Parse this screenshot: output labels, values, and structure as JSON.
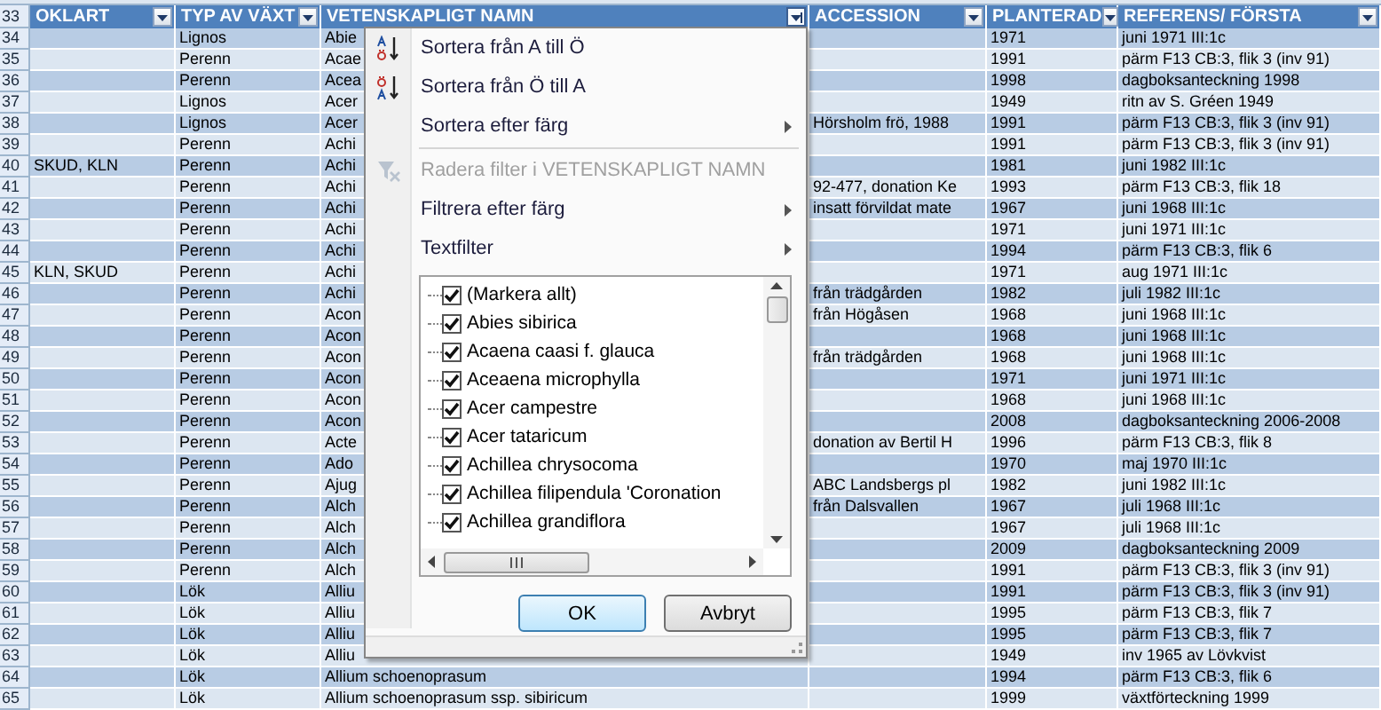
{
  "sheet": {
    "header_number": "33",
    "columns": [
      {
        "label": "OKLART",
        "filter_open": false
      },
      {
        "label": "TYP AV VÄXT",
        "filter_open": false
      },
      {
        "label": "VETENSKAPLIGT NAMN",
        "filter_open": true
      },
      {
        "label": "ACCESSION",
        "filter_open": false
      },
      {
        "label": "PLANTERAD",
        "filter_open": false
      },
      {
        "label": "REFERENS/ FÖRSTA",
        "filter_open": false
      }
    ],
    "rows": [
      {
        "number": "34",
        "typ_av_vaxt": "Lignos",
        "vetenskapligt_namn": "Abie",
        "planterad": "1971",
        "referens": "juni 1971 III:1c"
      },
      {
        "number": "35",
        "typ_av_vaxt": "Perenn",
        "vetenskapligt_namn": "Acae",
        "planterad": "1991",
        "referens": "pärm F13 CB:3, flik 3 (inv 91)"
      },
      {
        "number": "36",
        "typ_av_vaxt": "Perenn",
        "vetenskapligt_namn": "Acea",
        "planterad": "1998",
        "referens": "dagboksanteckning 1998"
      },
      {
        "number": "37",
        "typ_av_vaxt": "Lignos",
        "vetenskapligt_namn": "Acer",
        "planterad": "1949",
        "referens": "ritn av S. Gréen 1949"
      },
      {
        "number": "38",
        "typ_av_vaxt": "Lignos",
        "vetenskapligt_namn": "Acer",
        "accession": "Hörsholm frö, 1988",
        "planterad": "1991",
        "referens": "pärm F13 CB:3, flik 3 (inv 91)"
      },
      {
        "number": "39",
        "typ_av_vaxt": "Perenn",
        "vetenskapligt_namn": "Achi",
        "planterad": "1991",
        "referens": "pärm F13 CB:3, flik 3 (inv 91)"
      },
      {
        "number": "40",
        "oklart": "SKUD, KLN",
        "typ_av_vaxt": "Perenn",
        "vetenskapligt_namn": "Achi",
        "planterad": "1981",
        "referens": "juni 1982 III:1c"
      },
      {
        "number": "41",
        "typ_av_vaxt": "Perenn",
        "vetenskapligt_namn": "Achi",
        "accession": "92-477, donation Ke",
        "planterad": "1993",
        "referens": "pärm F13 CB:3, flik 18"
      },
      {
        "number": "42",
        "typ_av_vaxt": "Perenn",
        "vetenskapligt_namn": "Achi",
        "accession": "insatt förvildat mate",
        "planterad": "1967",
        "referens": "juni 1968 III:1c"
      },
      {
        "number": "43",
        "typ_av_vaxt": "Perenn",
        "vetenskapligt_namn": "Achi",
        "planterad": "1971",
        "referens": "juni 1971 III:1c"
      },
      {
        "number": "44",
        "typ_av_vaxt": "Perenn",
        "vetenskapligt_namn": "Achi",
        "planterad": "1994",
        "referens": "pärm F13 CB:3, flik 6"
      },
      {
        "number": "45",
        "oklart": "KLN, SKUD",
        "typ_av_vaxt": "Perenn",
        "vetenskapligt_namn": "Achi",
        "planterad": "1971",
        "referens": "aug 1971 III:1c"
      },
      {
        "number": "46",
        "typ_av_vaxt": "Perenn",
        "vetenskapligt_namn": "Achi",
        "accession": "från trädgården",
        "planterad": "1982",
        "referens": "juli 1982 III:1c"
      },
      {
        "number": "47",
        "typ_av_vaxt": "Perenn",
        "vetenskapligt_namn": "Acon",
        "accession": "från Högåsen",
        "planterad": "1968",
        "referens": "juni 1968 III:1c"
      },
      {
        "number": "48",
        "typ_av_vaxt": "Perenn",
        "vetenskapligt_namn": "Acon",
        "planterad": "1968",
        "referens": "juni 1968 III:1c"
      },
      {
        "number": "49",
        "typ_av_vaxt": "Perenn",
        "vetenskapligt_namn": "Acon",
        "accession": "från trädgården",
        "planterad": "1968",
        "referens": "juni 1968 III:1c"
      },
      {
        "number": "50",
        "typ_av_vaxt": "Perenn",
        "vetenskapligt_namn": "Acon",
        "planterad": "1971",
        "referens": "juni 1971 III:1c"
      },
      {
        "number": "51",
        "typ_av_vaxt": "Perenn",
        "vetenskapligt_namn": "Acon",
        "planterad": "1968",
        "referens": "juni 1968 III:1c"
      },
      {
        "number": "52",
        "typ_av_vaxt": "Perenn",
        "vetenskapligt_namn": "Acon",
        "planterad": "2008",
        "referens": "dagboksanteckning 2006-2008"
      },
      {
        "number": "53",
        "typ_av_vaxt": "Perenn",
        "vetenskapligt_namn": "Acte",
        "accession": "donation av Bertil H",
        "planterad": "1996",
        "referens": "pärm F13 CB:3, flik 8"
      },
      {
        "number": "54",
        "typ_av_vaxt": "Perenn",
        "vetenskapligt_namn": "Ado",
        "planterad": "1970",
        "referens": "maj 1970 III:1c"
      },
      {
        "number": "55",
        "typ_av_vaxt": "Perenn",
        "vetenskapligt_namn": "Ajug",
        "accession": "ABC Landsbergs pl",
        "planterad": "1982",
        "referens": "juni 1982 III:1c"
      },
      {
        "number": "56",
        "typ_av_vaxt": "Perenn",
        "vetenskapligt_namn": "Alch",
        "accession": "från Dalsvallen",
        "planterad": "1967",
        "referens": "juli 1968 III:1c"
      },
      {
        "number": "57",
        "typ_av_vaxt": "Perenn",
        "vetenskapligt_namn": "Alch",
        "planterad": "1967",
        "referens": "juli 1968 III:1c"
      },
      {
        "number": "58",
        "typ_av_vaxt": "Perenn",
        "vetenskapligt_namn": "Alch",
        "planterad": "2009",
        "referens": "dagboksanteckning 2009"
      },
      {
        "number": "59",
        "typ_av_vaxt": "Perenn",
        "vetenskapligt_namn": "Alch",
        "planterad": "1991",
        "referens": "pärm F13 CB:3, flik 3 (inv 91)"
      },
      {
        "number": "60",
        "typ_av_vaxt": "Lök",
        "vetenskapligt_namn": "Alliu",
        "planterad": "1991",
        "referens": "pärm F13 CB:3, flik 3 (inv 91)"
      },
      {
        "number": "61",
        "typ_av_vaxt": "Lök",
        "vetenskapligt_namn": "Alliu",
        "planterad": "1995",
        "referens": "pärm F13 CB:3, flik 7"
      },
      {
        "number": "62",
        "typ_av_vaxt": "Lök",
        "vetenskapligt_namn": "Alliu",
        "planterad": "1995",
        "referens": "pärm F13 CB:3, flik 7"
      },
      {
        "number": "63",
        "typ_av_vaxt": "Lök",
        "vetenskapligt_namn": "Alliu",
        "planterad": "1949",
        "referens": "inv 1965 av Lövkvist"
      },
      {
        "number": "64",
        "typ_av_vaxt": "Lök",
        "vetenskapligt_namn": "Allium schoenoprasum",
        "planterad": "1994",
        "referens": "pärm F13 CB:3, flik 6"
      },
      {
        "number": "65",
        "typ_av_vaxt": "Lök",
        "vetenskapligt_namn": "Allium schoenoprasum ssp. sibiricum",
        "planterad": "1999",
        "referens": "växtförteckning 1999"
      }
    ]
  },
  "filter_menu": {
    "items": [
      {
        "kind": "sort-asc",
        "label": "Sortera från A till Ö",
        "disabled": false,
        "submenu": false,
        "separator_after": false
      },
      {
        "kind": "sort-desc",
        "label": "Sortera från Ö till A",
        "disabled": false,
        "submenu": false,
        "separator_after": false
      },
      {
        "kind": "plain",
        "label": "Sortera efter färg",
        "disabled": false,
        "submenu": true,
        "separator_after": true
      },
      {
        "kind": "clear-filter",
        "label": "Radera filter i VETENSKAPLIGT NAMN",
        "disabled": true,
        "submenu": false,
        "separator_after": false
      },
      {
        "kind": "plain",
        "label": "Filtrera efter färg",
        "disabled": false,
        "submenu": true,
        "separator_after": false
      },
      {
        "kind": "plain",
        "label": "Textfilter",
        "disabled": false,
        "submenu": true,
        "separator_after": false
      }
    ],
    "checklist": [
      {
        "label": "(Markera allt)",
        "checked": true
      },
      {
        "label": "Abies sibirica",
        "checked": true
      },
      {
        "label": "Acaena caasi f. glauca",
        "checked": true
      },
      {
        "label": "Aceaena microphylla",
        "checked": true
      },
      {
        "label": "Acer campestre",
        "checked": true
      },
      {
        "label": "Acer tataricum",
        "checked": true
      },
      {
        "label": "Achillea chrysocoma",
        "checked": true
      },
      {
        "label": "Achillea filipendula 'Coronation",
        "checked": true
      },
      {
        "label": "Achillea grandiflora",
        "checked": true
      }
    ],
    "buttons": [
      {
        "label": "OK",
        "default": true
      },
      {
        "label": "Avbryt",
        "default": false
      }
    ]
  }
}
